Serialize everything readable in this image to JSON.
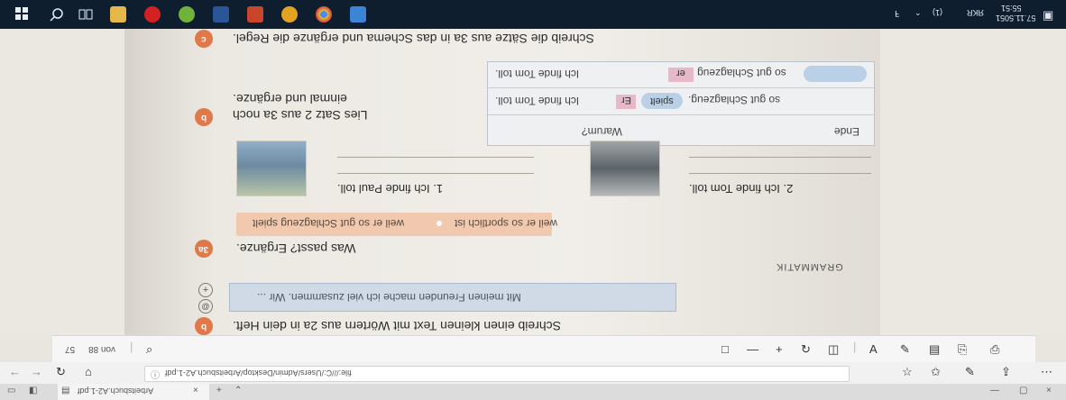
{
  "taskbar": {
    "clock": "55:51",
    "date": "57.11.5051",
    "lang": "ЯKR",
    "volume": "(1)",
    "tray_ic": "ꟻ"
  },
  "document": {
    "section_c": {
      "badge": "c",
      "heading": "Schreib die Sätze aus 3a in das Schema und ergänze die Regel.",
      "heading_ref": "3a"
    },
    "section_b_top": {
      "badge": "b",
      "line1": "Lies Satz 2 aus 3a noch",
      "line2": "einmal und ergänze."
    },
    "table": {
      "col_ende": "Ende",
      "col_warum": "Warum?",
      "row1_left": "Ich finde Tom toll.",
      "row1_er": "Er",
      "row1_verb": "spielt",
      "row1_rest": "so gut Schlagzeug.",
      "row2_left": "Ich finde Tom toll.",
      "row2_er": "er",
      "row2_rest": "so gut Schlagzeug"
    },
    "badge_3": "3",
    "badge_2": "2",
    "photo_captions": {
      "left": "1. Ich finde Paul toll.",
      "right": "2. Ich finde Tom toll."
    },
    "pill": {
      "option1": "weil er so gut Schlagzeug spielt",
      "option2": "weil er so sportlich ist"
    },
    "section_3a": {
      "badge": "3a",
      "heading": "Was passt? Ergänze."
    },
    "grammatik_label": "GRAMMATIK",
    "example_box": "Mit meinen Freunden mache ich viel zusammen. Wir ...",
    "section_b_bottom": {
      "badge": "b",
      "heading": "Schreib einen kleinen Text mit Wörtern aus 2a in dein Heft."
    }
  },
  "viewer_toolbar": {
    "page_current": "57",
    "page_total": "von 88"
  },
  "address_bar": {
    "url": "file:///C:/Users/Admin/Desktop/Arbeitsbuch.A2-1.pdf"
  },
  "tab": {
    "title": "Arbeitsbuch.A2-1.pdf"
  }
}
